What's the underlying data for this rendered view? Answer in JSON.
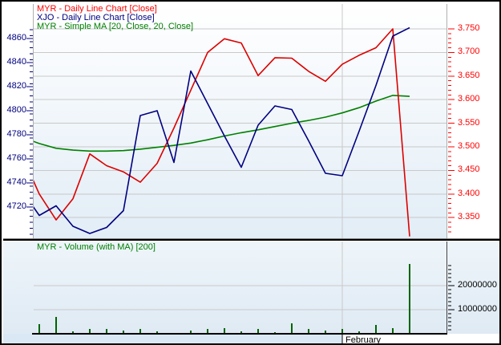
{
  "window": {
    "background": "#ffffff",
    "border_color": "#000000"
  },
  "chart_data": {
    "type": "line",
    "title": "",
    "panels": [
      "price",
      "volume"
    ],
    "n_points": 24,
    "series": [
      {
        "name": "MYR - Daily Line Chart [Close]",
        "axis": "right",
        "color": "#dd0000",
        "values": [
          3.48,
          3.4,
          3.345,
          3.39,
          3.485,
          3.46,
          3.447,
          3.425,
          3.465,
          3.54,
          3.62,
          3.7,
          3.729,
          3.72,
          3.651,
          3.689,
          3.688,
          3.66,
          3.639,
          3.675,
          3.694,
          3.71,
          3.75,
          3.31
        ]
      },
      {
        "name": "XJO - Daily Line Chart [Close]",
        "axis": "left",
        "color": "#000080",
        "values": [
          4733,
          4713,
          4721,
          4704,
          4698,
          4703,
          4717,
          4796,
          4800,
          4757,
          4833,
          4806,
          4779,
          4753,
          4788,
          4804,
          4801,
          4775,
          4748,
          4746,
          4783,
          4821,
          4862,
          4869
        ]
      },
      {
        "name": "MYR - Simple MA [20, Close, 20, Close]",
        "axis": "right",
        "color": "#008000",
        "values": [
          3.52,
          3.507,
          3.497,
          3.493,
          3.491,
          3.491,
          3.492,
          3.495,
          3.499,
          3.503,
          3.508,
          3.515,
          3.523,
          3.53,
          3.536,
          3.543,
          3.55,
          3.556,
          3.563,
          3.572,
          3.583,
          3.597,
          3.609,
          3.607
        ]
      }
    ],
    "volume": {
      "name": "MYR - Volume (with MA) [200]",
      "color": "#006400",
      "values": [
        0,
        4000000,
        7000000,
        1000000,
        2000000,
        2000000,
        1300000,
        2000000,
        1000000,
        400000,
        1300000,
        2000000,
        2300000,
        1000000,
        2000000,
        700000,
        4300000,
        2000000,
        1300000,
        2000000,
        1000000,
        3700000,
        2300000,
        29000000
      ]
    },
    "axes": {
      "left": {
        "color": "#000080",
        "ticks": [
          4860,
          4840,
          4820,
          4800,
          4780,
          4760,
          4740,
          4720
        ],
        "range": [
          4694,
          4889
        ]
      },
      "right": {
        "color": "#ff0000",
        "ticks": [
          3.75,
          3.7,
          3.65,
          3.6,
          3.55,
          3.5,
          3.45,
          3.4,
          3.35
        ],
        "range": [
          3.306,
          3.803
        ],
        "decimals": 3
      },
      "volume_right": {
        "color": "#000000",
        "ticks": [
          20000000,
          10000000
        ]
      },
      "x": {
        "month_label": "February",
        "month_start_index": 19
      }
    },
    "grid": {
      "color": "#c9c9c9",
      "horizontal": true,
      "vertical_at_month_start": true
    }
  }
}
